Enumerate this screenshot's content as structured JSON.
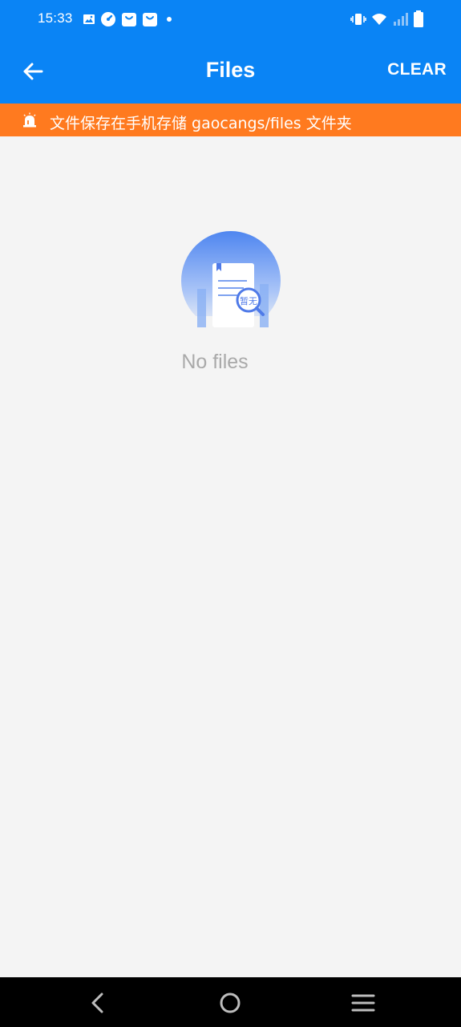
{
  "status_bar": {
    "time": "15:33",
    "left_icons": [
      "image-icon",
      "speed-dial-icon",
      "shopping-bag-icon",
      "shopping-bag-icon",
      "dot-icon"
    ],
    "right_icons": [
      "vibrate-icon",
      "wifi-icon",
      "signal-icon",
      "battery-icon"
    ]
  },
  "app_bar": {
    "title": "Files",
    "back_icon": "arrow-left-icon",
    "clear_label": "CLEAR"
  },
  "notice": {
    "icon": "alarm-bell-icon",
    "text": "文件保存在手机存储 gaocangs/files 文件夹"
  },
  "empty_state": {
    "illustration_label": "暂无",
    "message": "No files"
  },
  "nav_bar": {
    "buttons": [
      "back-nav-icon",
      "home-nav-icon",
      "menu-nav-icon"
    ]
  },
  "colors": {
    "primary": "#0a84f5",
    "notice_bg": "#ff7a1f",
    "background": "#f4f4f4",
    "muted_text": "#a9a9a9"
  }
}
